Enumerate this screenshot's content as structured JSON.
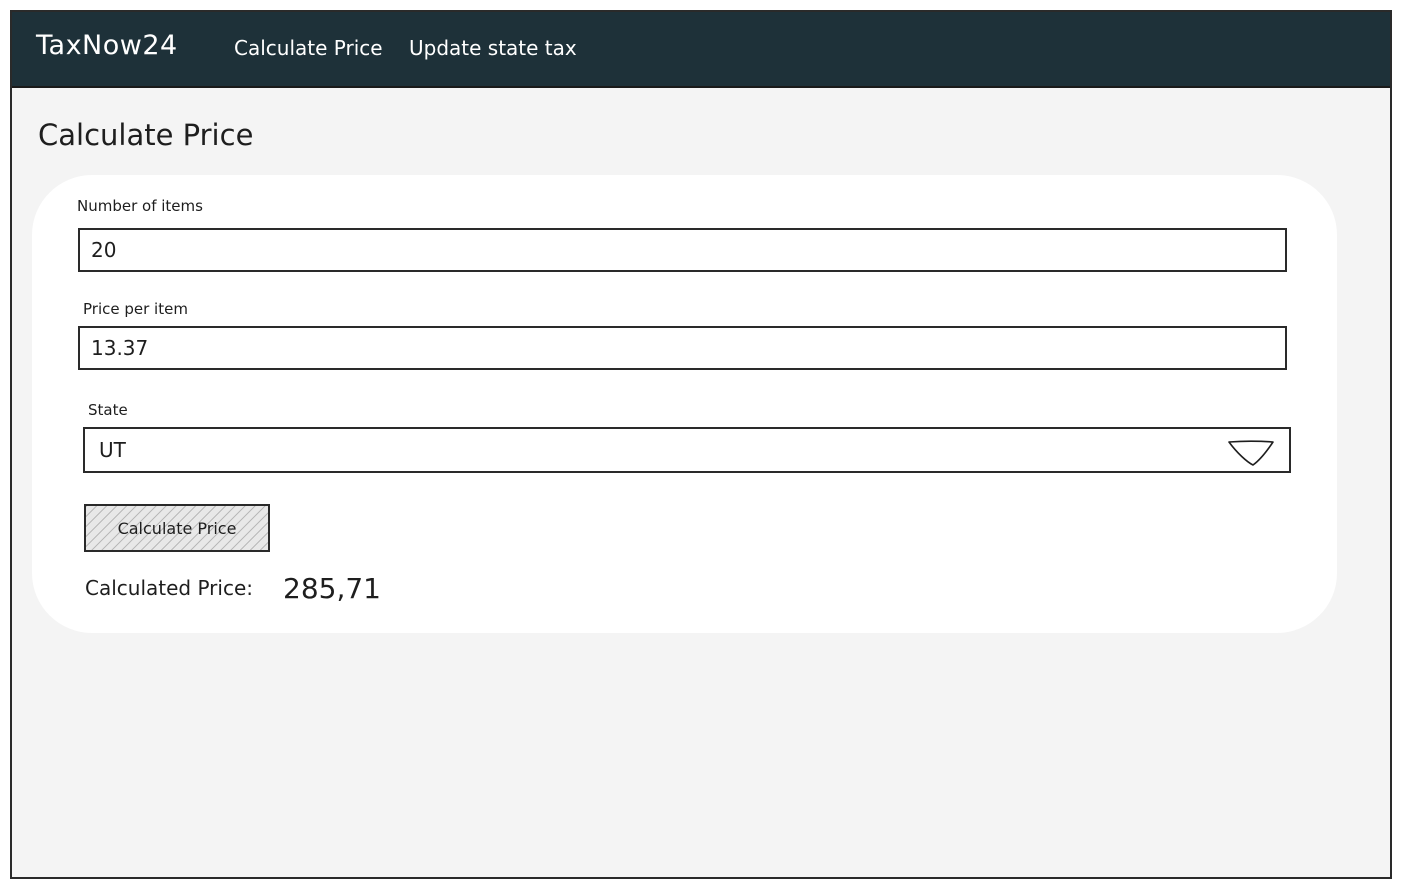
{
  "navbar": {
    "brand": "TaxNow24",
    "links": [
      {
        "label": "Calculate Price"
      },
      {
        "label": "Update state tax"
      }
    ]
  },
  "page": {
    "title": "Calculate Price"
  },
  "form": {
    "items_label": "Number of items",
    "items_value": "20",
    "price_label": "Price per item",
    "price_value": "13.37",
    "state_label": "State",
    "state_value": "UT",
    "button_label": "Calculate Price",
    "result_label": "Calculated Price:",
    "result_value": "285,71"
  },
  "icons": {
    "select_arrow": "chevron-down-icon"
  },
  "colors": {
    "navbar_bg": "#1e3139",
    "page_bg": "#f4f4f4",
    "card_bg": "#ffffff",
    "ink": "#1e1e1e"
  }
}
